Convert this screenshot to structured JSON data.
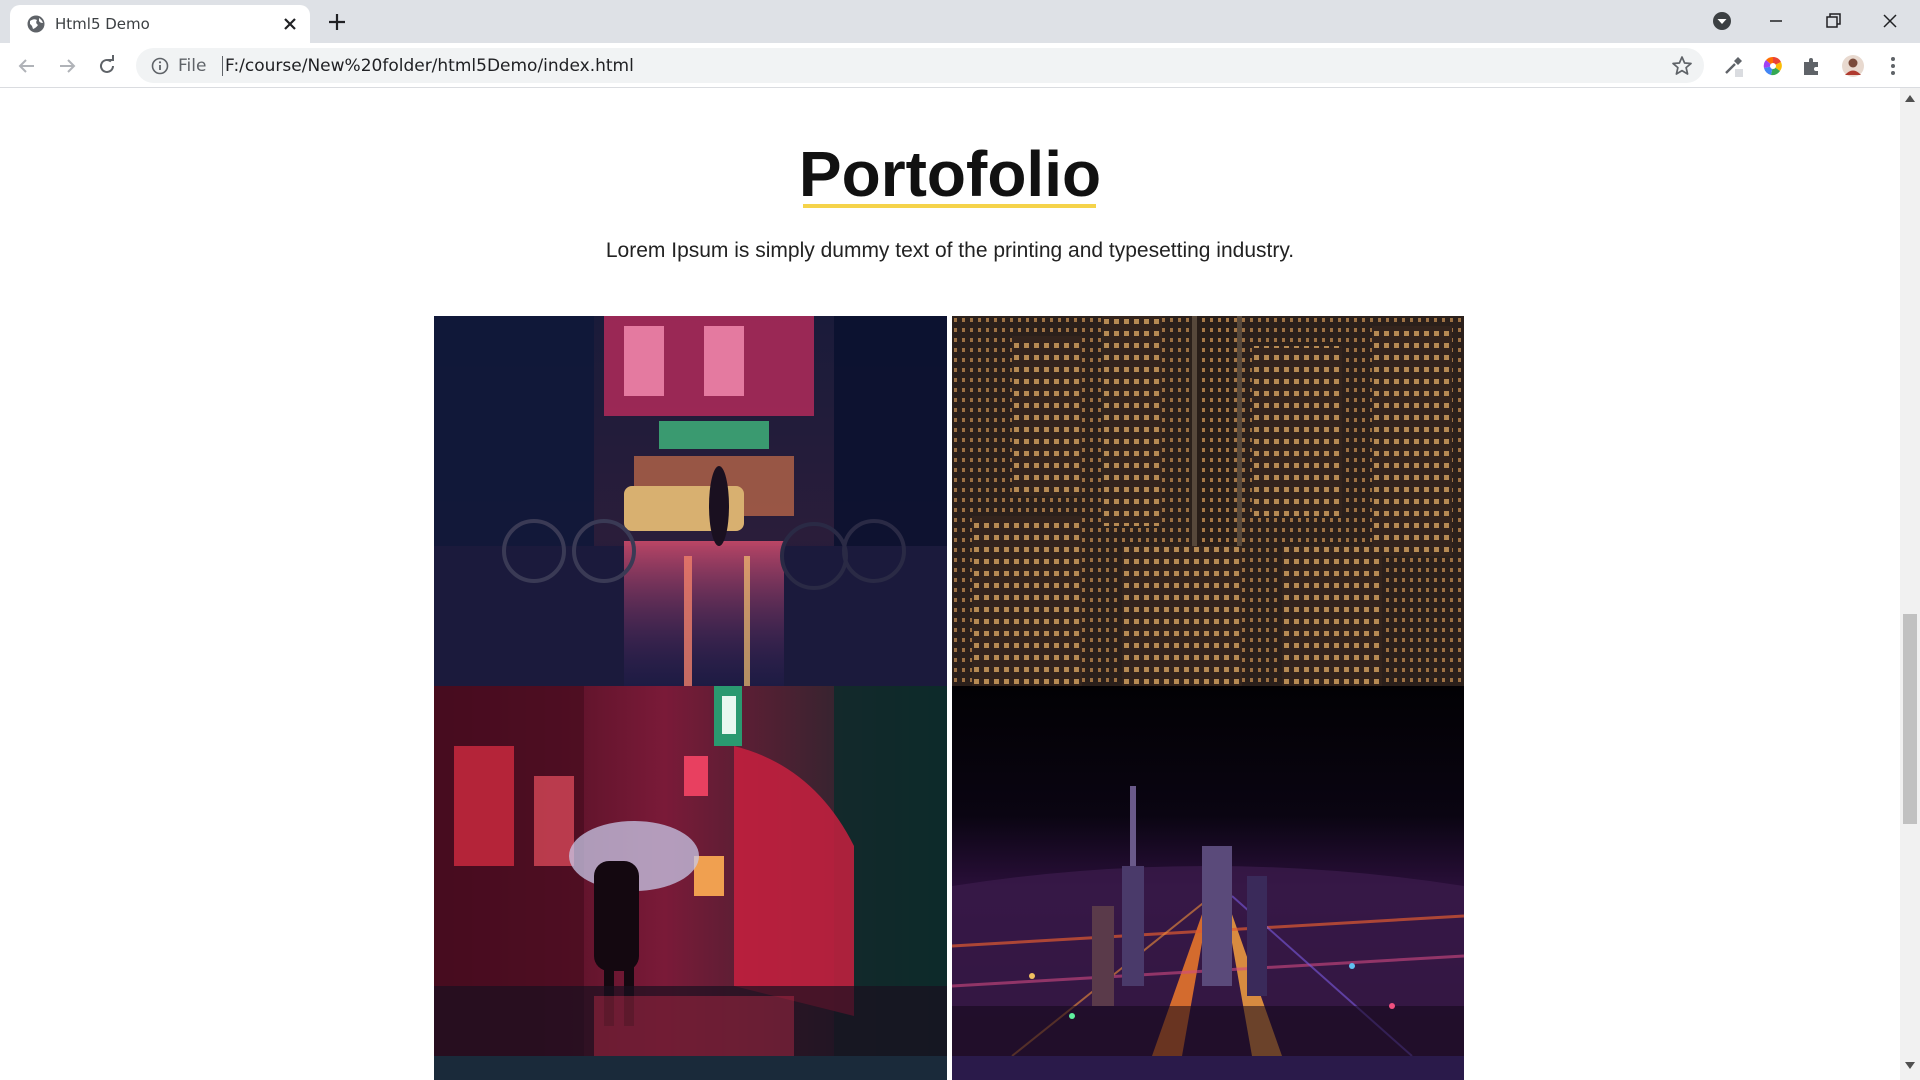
{
  "browser": {
    "tab_title": "Html5 Demo",
    "file_label": "File",
    "url": "F:/course/New%20folder/html5Demo/index.html"
  },
  "page": {
    "heading": "Portofolio",
    "subtitle": "Lorem Ipsum is simply dummy text of the printing and typesetting industry.",
    "accent_color": "#f5d34a"
  },
  "gallery": {
    "images": [
      {
        "name": "neon-street-taxi-photo"
      },
      {
        "name": "city-skyscrapers-night-photo"
      },
      {
        "name": "alley-umbrella-photo"
      },
      {
        "name": "aerial-city-lights-photo"
      }
    ]
  }
}
